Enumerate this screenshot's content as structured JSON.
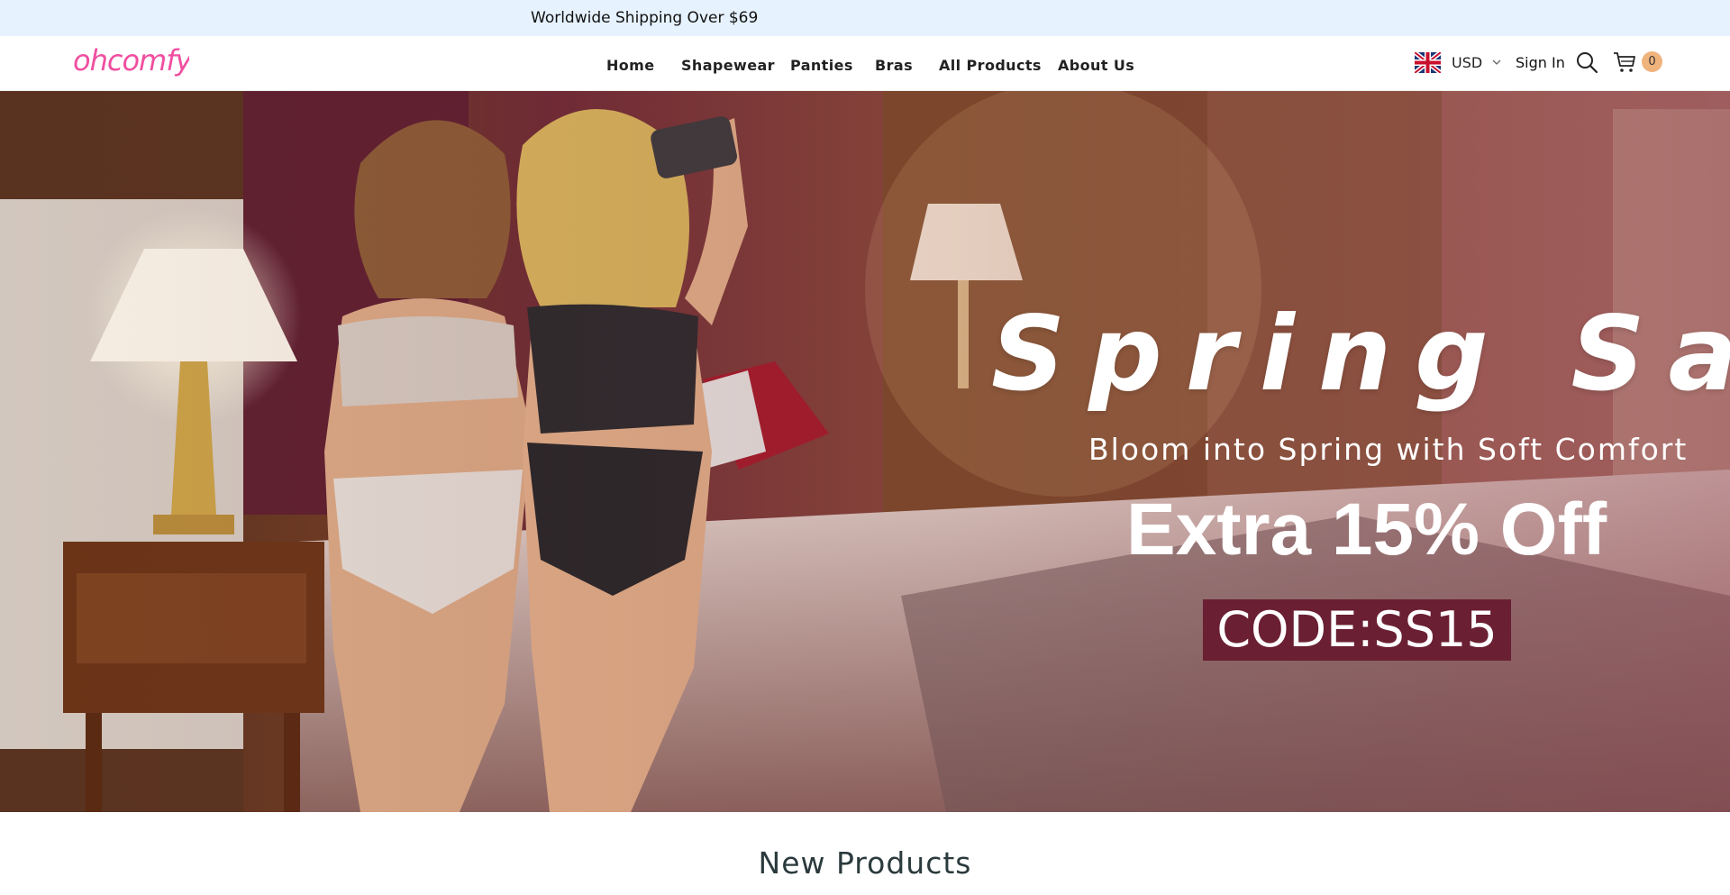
{
  "announcement": {
    "text": "Worldwide Shipping Over $69"
  },
  "header": {
    "logo_text": "ohcomfy",
    "brand_color": "#f04fa0",
    "nav": [
      "Home",
      "Shapewear",
      "Panties",
      "Bras",
      "All Products",
      "About Us"
    ],
    "currency": {
      "flag_icon": "uk-flag-icon",
      "code": "USD"
    },
    "sign_in": "Sign In",
    "icons": {
      "search": "search-icon",
      "cart": "cart-icon"
    },
    "cart_count": "0"
  },
  "hero": {
    "title": "Spring Sale",
    "subtitle": "Bloom into Spring with Soft Comfort",
    "offer": "Extra 15% Off",
    "code": "CODE:SS15",
    "code_bg_color": "#6a1f33"
  },
  "section": {
    "title": "New Products"
  }
}
